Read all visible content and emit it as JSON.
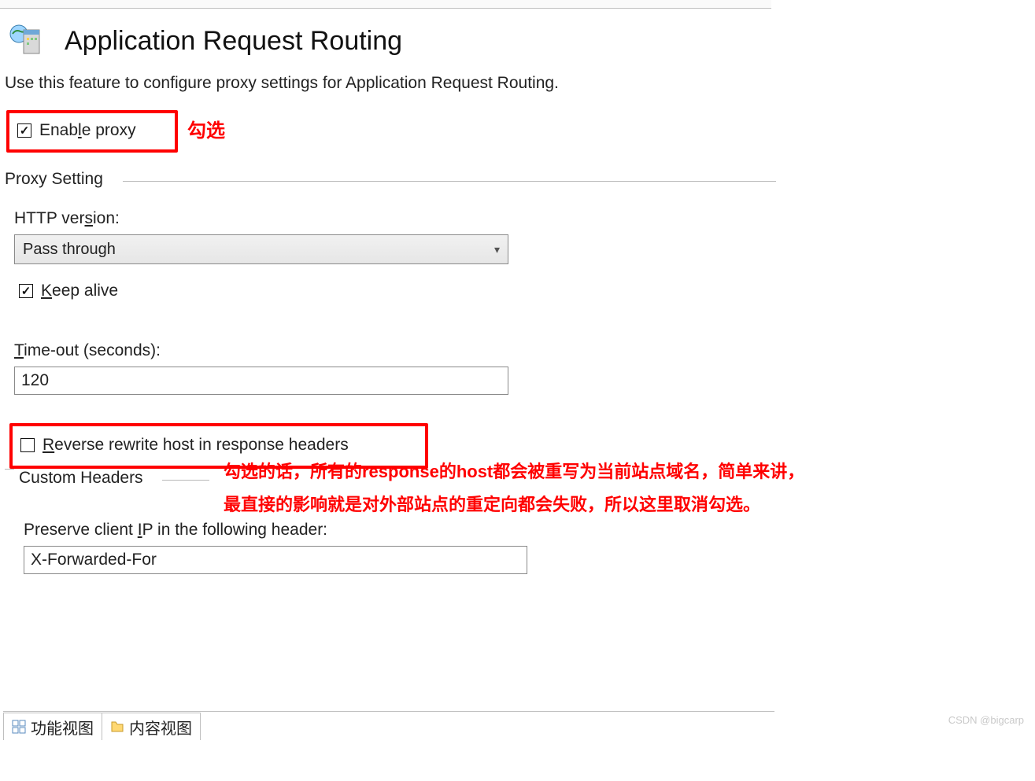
{
  "header": {
    "title": "Application Request Routing",
    "description": "Use this feature to configure proxy settings for Application Request Routing."
  },
  "enable_proxy": {
    "label": "Enable proxy",
    "checked": true
  },
  "annot": {
    "check_label": "勾选",
    "reverse_note_line1": "勾选的话，所有的response的host都会被重写为当前站点域名，简单来讲，",
    "reverse_note_line2": "最直接的影响就是对外部站点的重定向都会失败，所以这里取消勾选。"
  },
  "proxy_setting": {
    "legend": "Proxy Setting",
    "http_version": {
      "label": "HTTP version:",
      "value": "Pass through"
    },
    "keep_alive": {
      "label": "Keep alive",
      "checked": true
    },
    "timeout": {
      "label": "Time-out (seconds):",
      "value": "120"
    },
    "reverse_rewrite": {
      "label": "Reverse rewrite host in response headers",
      "checked": false
    }
  },
  "custom_headers": {
    "legend": "Custom Headers",
    "preserve_ip": {
      "label": "Preserve client IP in the following header:",
      "value": "X-Forwarded-For"
    }
  },
  "tabs": {
    "features": "功能视图",
    "content": "内容视图"
  },
  "watermark": "CSDN @bigcarp"
}
